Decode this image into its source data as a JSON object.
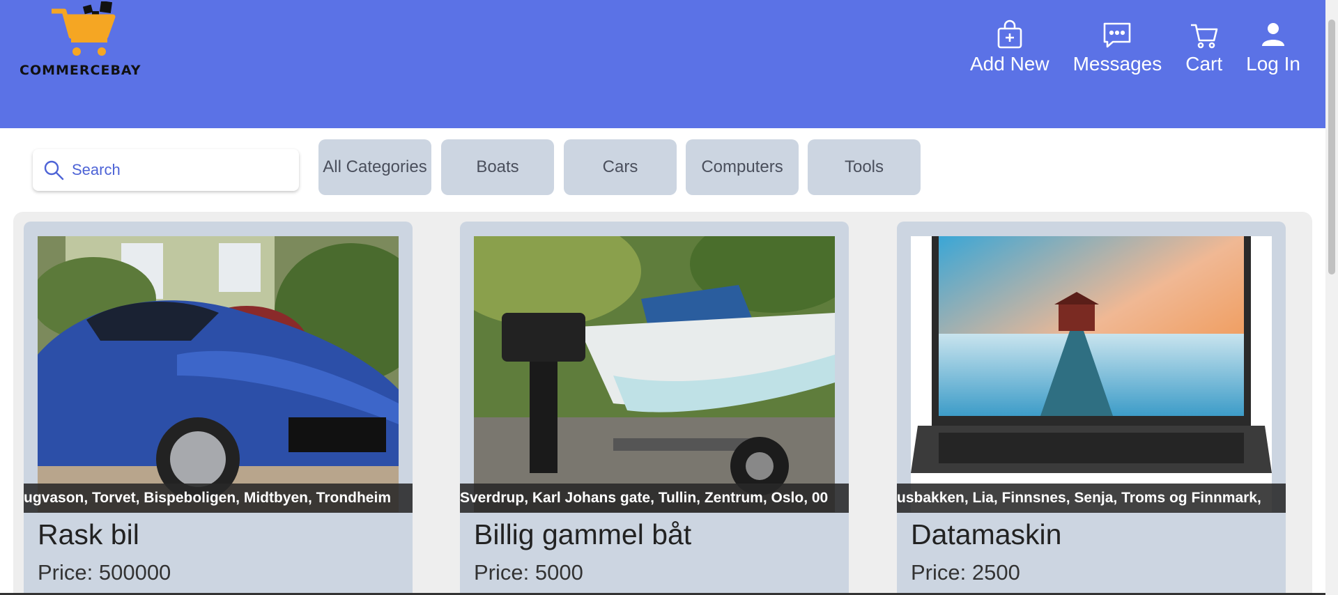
{
  "brand": {
    "name": "COMMERCEBAY",
    "accent_color": "#5b72e6",
    "logo_color": "#f5a623"
  },
  "nav": [
    {
      "label": "Add New",
      "icon": "add-bag-icon"
    },
    {
      "label": "Messages",
      "icon": "message-icon"
    },
    {
      "label": "Cart",
      "icon": "cart-icon"
    },
    {
      "label": "Log In",
      "icon": "user-icon"
    }
  ],
  "search": {
    "placeholder": "Search",
    "value": ""
  },
  "categories": [
    "All Categories",
    "Boats",
    "Cars",
    "Computers",
    "Tools"
  ],
  "listings": [
    {
      "title": "Rask bil",
      "price": "Price: 500000",
      "location": "ugvason, Torvet, Bispeboligen, Midtbyen, Trondheim",
      "image": "blue-sports-car"
    },
    {
      "title": "Billig gammel båt",
      "price": "Price: 5000",
      "location": "Sverdrup, Karl Johans gate, Tullin, Zentrum, Oslo, 00",
      "image": "boat-on-trailer"
    },
    {
      "title": "Datamaskin",
      "price": "Price: 2500",
      "location": "usbakken, Lia, Finnsnes, Senja, Troms og Finnmark,",
      "image": "laptop-with-pier"
    }
  ]
}
